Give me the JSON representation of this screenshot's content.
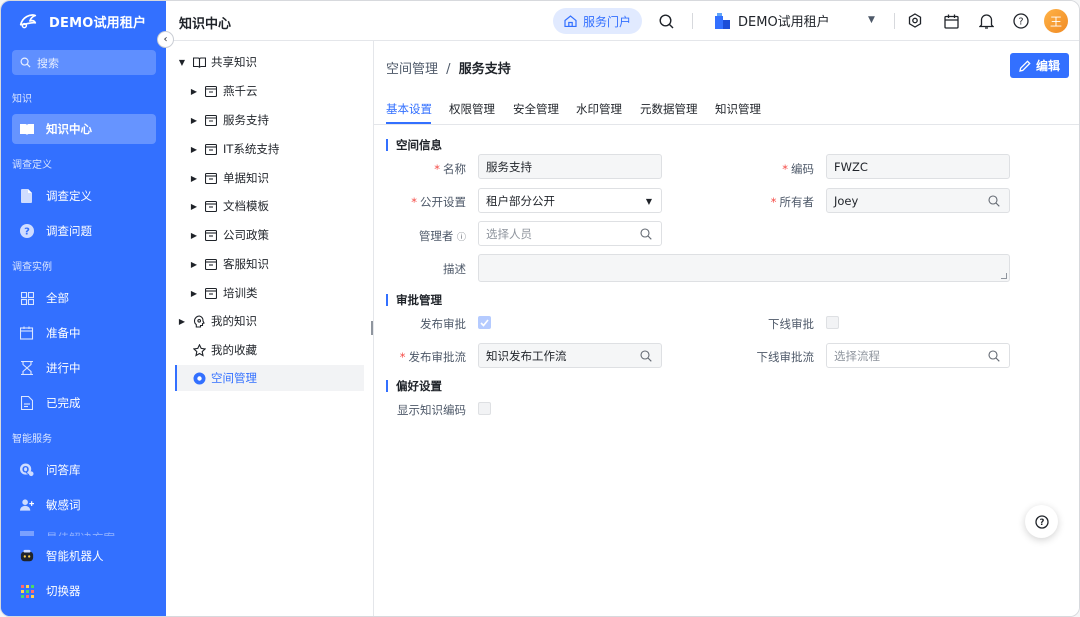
{
  "brand": {
    "name": "DEMO试用租户"
  },
  "sidebar": {
    "search_placeholder": "搜索",
    "groups": {
      "knowledge": "知识",
      "survey_def": "调查定义",
      "survey_inst": "调查实例",
      "smart": "智能服务"
    },
    "items": {
      "knowledge_center": "知识中心",
      "survey_definition": "调查定义",
      "survey_question": "调查问题",
      "all": "全部",
      "preparing": "准备中",
      "in_progress": "进行中",
      "completed": "已完成",
      "qa_library": "问答库",
      "sensitive_words": "敏感词",
      "best_solution": "最佳解决方案",
      "robot": "智能机器人",
      "switcher": "切换器"
    }
  },
  "header": {
    "title": "知识中心",
    "portal": "服务门户",
    "tenant": "DEMO试用租户",
    "avatar": "王"
  },
  "tree": {
    "root": "共享知识",
    "children": [
      "燕千云",
      "服务支持",
      "IT系统支持",
      "单据知识",
      "文档模板",
      "公司政策",
      "客服知识",
      "培训类"
    ],
    "my_knowledge": "我的知识",
    "favorites": "我的收藏",
    "space_mgmt": "空间管理"
  },
  "main": {
    "crumb_parent": "空间管理",
    "crumb_sep": "/",
    "crumb_current": "服务支持",
    "edit_label": "编辑",
    "tabs": [
      "基本设置",
      "权限管理",
      "安全管理",
      "水印管理",
      "元数据管理",
      "知识管理"
    ],
    "sections": {
      "space_info": "空间信息",
      "approval": "审批管理",
      "preference": "偏好设置"
    },
    "form": {
      "name_label": "名称",
      "name_value": "服务支持",
      "code_label": "编码",
      "code_value": "FWZC",
      "public_label": "公开设置",
      "public_value": "租户部分公开",
      "owner_label": "所有者",
      "owner_value": "Joey",
      "admin_label": "管理者",
      "admin_placeholder": "选择人员",
      "desc_label": "描述",
      "publish_approval_label": "发布审批",
      "offline_approval_label": "下线审批",
      "publish_flow_label": "发布审批流",
      "publish_flow_value": "知识发布工作流",
      "offline_flow_label": "下线审批流",
      "offline_flow_placeholder": "选择流程",
      "show_code_label": "显示知识编码",
      "required_mark": "*"
    }
  },
  "colors": {
    "primary": "#3370ff",
    "required": "#f54a45"
  }
}
